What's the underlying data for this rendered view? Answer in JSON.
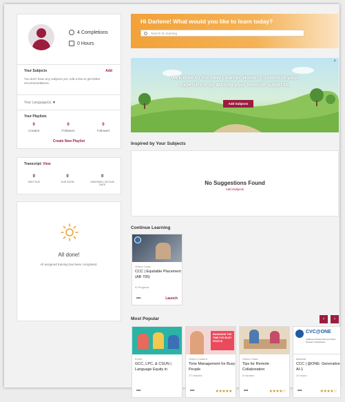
{
  "profile": {
    "completions": "4 Completions",
    "hours": "0 Hours"
  },
  "subjects": {
    "title": "Your Subjects",
    "add_label": "Add",
    "empty_text": "You don't have any subjects yet. Add a few to get better recommendations."
  },
  "languages": {
    "label": "Your Language(s)"
  },
  "playlists": {
    "title": "Your Playlists",
    "stats": [
      {
        "num": "0",
        "label": "Created"
      },
      {
        "num": "0",
        "label": "Followers"
      },
      {
        "num": "0",
        "label": "Followed"
      }
    ],
    "create_label": "Create New Playlist"
  },
  "transcript": {
    "title": "Transcript:",
    "view_label": "View",
    "stats": [
      {
        "num": "0",
        "label": "PAST DUE"
      },
      {
        "num": "0",
        "label": "DUE SOON"
      },
      {
        "num": "0",
        "label": "ASSIGNED / NO DUE DATE"
      }
    ]
  },
  "alldone": {
    "title": "All done!",
    "subtitle": "All assigned training has been completed."
  },
  "header": {
    "greeting": "Hi Darlene! What would you like to learn today?",
    "search_placeholder": "Search for learning"
  },
  "banner": {
    "message": "Welcome to the new Learner Home! Customize your experience by adding your favorite subjects.",
    "button": "Add Subjects",
    "close": "×"
  },
  "inspired": {
    "title": "Inspired by Your Subjects",
    "empty_title": "No Suggestions Found",
    "empty_link": "Add Subjects"
  },
  "continue": {
    "title": "Continue Learning",
    "course": {
      "type": "Online Class",
      "title": "CCC | Equitable Placement (AB 705)",
      "status": "In Progress",
      "dots": "•••",
      "launch": "Launch"
    }
  },
  "popular": {
    "title": "Most Popular",
    "prev": "‹",
    "next": "›",
    "items": [
      {
        "type": "Event",
        "title": "GCC, LPC, & CSUN | Language Equity in",
        "meta": "",
        "stars": "",
        "dots": "•••"
      },
      {
        "type": "Online Content",
        "title": "Time Management for Busy People",
        "meta": "27 minutes",
        "stars": "★★★★★",
        "dots": "•••"
      },
      {
        "type": "Online Class",
        "title": "Tips for Remote Collaboration",
        "meta": "5 minutes",
        "stars": "★★★★☆",
        "dots": "•••"
      },
      {
        "type": "Material",
        "title": "CCC | @ONE: Generative AI-1",
        "meta": "10 hours",
        "stars": "★★★★☆",
        "dots": "•••"
      }
    ],
    "thumb_texts": {
      "time_mgmt": "MANAGING THE TIME FOR BUSY PEOPLE",
      "onecc": "CVC@ONE",
      "onecc_sub": "California Virtual Campus Online Network of Educators"
    }
  },
  "colors": {
    "accent": "#9b1c3f",
    "header": "#f2a23a",
    "stars": "#c9962b"
  }
}
